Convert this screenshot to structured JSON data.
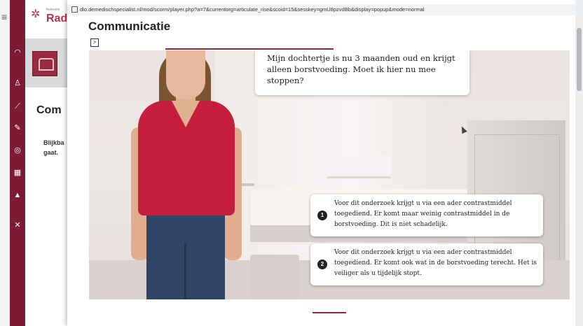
{
  "app": {
    "logo_small": "federatie",
    "logo_text": "Rad",
    "rail_icons": [
      "graduation-cap-icon",
      "users-icon",
      "chart-icon",
      "edit-icon",
      "compass-icon",
      "calendar-icon",
      "mortarboard-icon",
      "tools-icon"
    ]
  },
  "background_page": {
    "title": "Com",
    "text": "Blijkba gaat."
  },
  "popup": {
    "url": "dlo.demedischspecialist.nl/mod/scorm/player.php?a=7&currentorg=articulate_rise&scoid=15&sesskey=gmU8pzvdBb&display=popup&mode=normal",
    "title": "Communicatie",
    "toggle_label": ">"
  },
  "scene": {
    "speech": "Mijn dochtertje is nu 3 maanden oud en krijgt alleen borstvoeding. Moet ik hier nu mee stoppen?",
    "options": [
      {
        "number": "1",
        "text": "Voor dit onderzoek krijgt u via een ader contrastmiddel toegediend. Er komt maar weinig contrastmiddel in de borstvoeding. Dit is niet schadelijk."
      },
      {
        "number": "2",
        "text": "Voor dit onderzoek krijgt u via een ader contrastmiddel toegediend. Er komt ook wat in de borstvoeding terecht. Het is veiliger als u tijdelijk stopt."
      }
    ]
  },
  "colors": {
    "brand": "#7d1b34",
    "accent": "#8c2a3a",
    "shirt": "#c61f3e"
  }
}
